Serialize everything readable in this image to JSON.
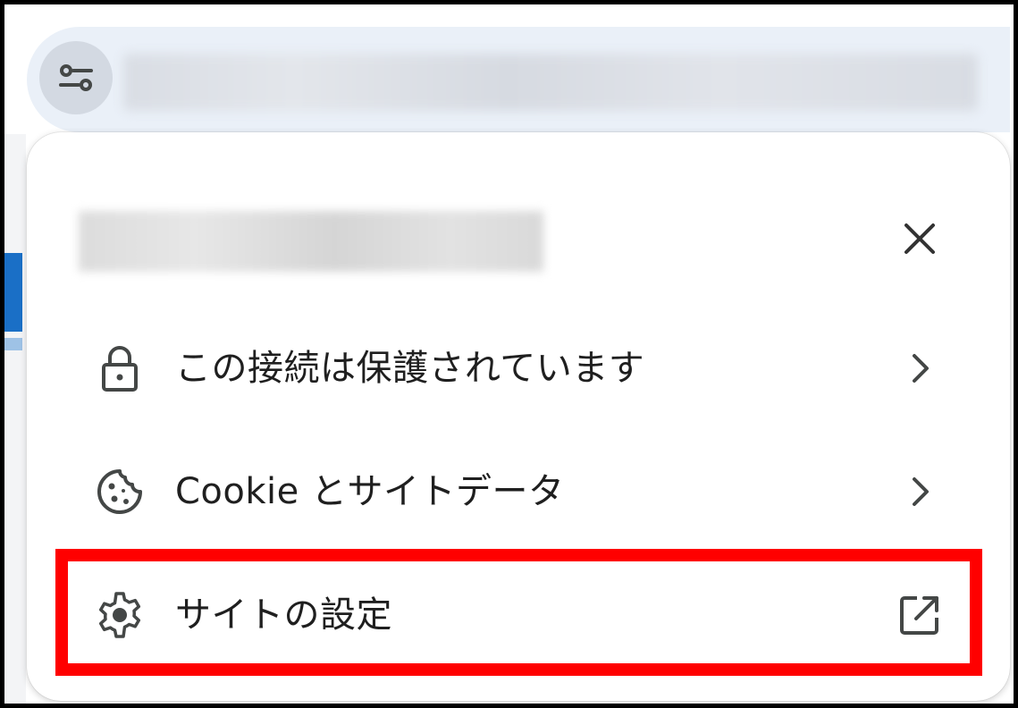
{
  "address_bar": {
    "site_info_icon": "tune-icon"
  },
  "popup": {
    "close_icon": "close-icon",
    "items": [
      {
        "label": "この接続は保護されています",
        "icon": "lock-icon",
        "trailing_icon": "chevron-right-icon"
      },
      {
        "label": "Cookie とサイトデータ",
        "icon": "cookie-icon",
        "trailing_icon": "chevron-right-icon"
      },
      {
        "label": "サイトの設定",
        "icon": "gear-icon",
        "trailing_icon": "open-in-new-icon"
      }
    ]
  },
  "colors": {
    "highlight": "#ff0000",
    "text": "#1f1f1f",
    "icon": "#444746",
    "address_bar_bg": "#eaf0f8"
  }
}
